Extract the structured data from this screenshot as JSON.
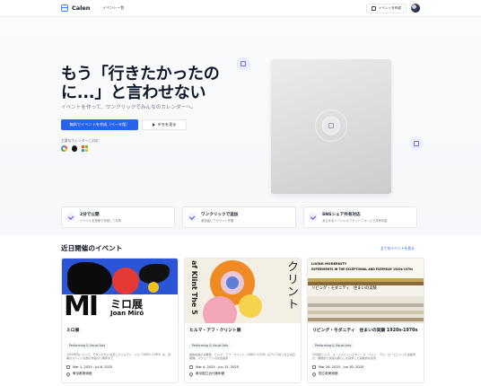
{
  "header": {
    "logo_text": "Calen",
    "nav_events": "イベント一覧",
    "create_label": "イベントを作成"
  },
  "hero": {
    "title": "もう「行きたかったのに...」と言わせない",
    "subtitle": "イベントを作って、ワンクリックでみんなのカレンダーへ。",
    "primary_button": "無料でイベントを作成（ベータ版）",
    "demo_button": "デモを見る",
    "supported_label": "主要なカレンダーに対応："
  },
  "features": [
    {
      "title": "2分で公開",
      "desc": "イベントを簡単で作成して共有"
    },
    {
      "title": "ワンクリックで追加",
      "desc": "参加者にアカウント不要"
    },
    {
      "title": "SNSシェア共有対応",
      "desc": "あらゆるソーシャルプラットフォームで共有可能"
    }
  ],
  "events_section": {
    "title": "近日開催のイベント",
    "see_all": "全てのイベントを見る"
  },
  "events": [
    {
      "title": "ミロ展",
      "category": "Performing & Visual Arts",
      "description": "1920年代にパリで、モダンたちに交流したジョアン・ミロ（1893～1983）は、初期のスペイン北部の作品から晩年まで",
      "date": "Mar 1, 2025 - Jul 6, 2025",
      "venue": "東京都美術館",
      "poster_text_big": "MI",
      "poster_text_ten": "ミロ展",
      "poster_text_name": "Joan Miró"
    },
    {
      "title": "ヒルマ・アフ・クリント展",
      "category": "Performing & Visual Arts",
      "description": "抽象絵画の先駆者、ヒルマ・アフ・クリント（1862～1944）のアジア初となる大回顧展。スウェーデンの女性画家",
      "date": "Mar 4, 2025 - Jun 15, 2025",
      "venue": "東京国立近代美術館",
      "poster_vertical": "af Klint The 5",
      "poster_kata": "クリント"
    },
    {
      "title": "リビング・モダニティ　住まいの実験 1920s-1970s",
      "category": "Performing & Visual Arts",
      "description": "20世紀に入り、ル・コルビュジエやミース・ファン・デル・ローエといった建築家が、機能的で快適な暮らしを追求した実験的な住宅",
      "date": "Mar 26, 2025 - Jun 30, 2025",
      "venue": "国立新美術館",
      "poster_t1": "LIVING MODERNITY",
      "poster_t2": "EXPERIMENTS IN THE EXCEPTIONAL AND EVERYDAY 1920s-1970s",
      "poster_jp": "リビング・モダニティ　住まいの実験"
    }
  ],
  "colors": {
    "primary": "#2563eb",
    "hero_bg": "#f5f7fa",
    "text": "#111827",
    "muted": "#6b7280"
  }
}
